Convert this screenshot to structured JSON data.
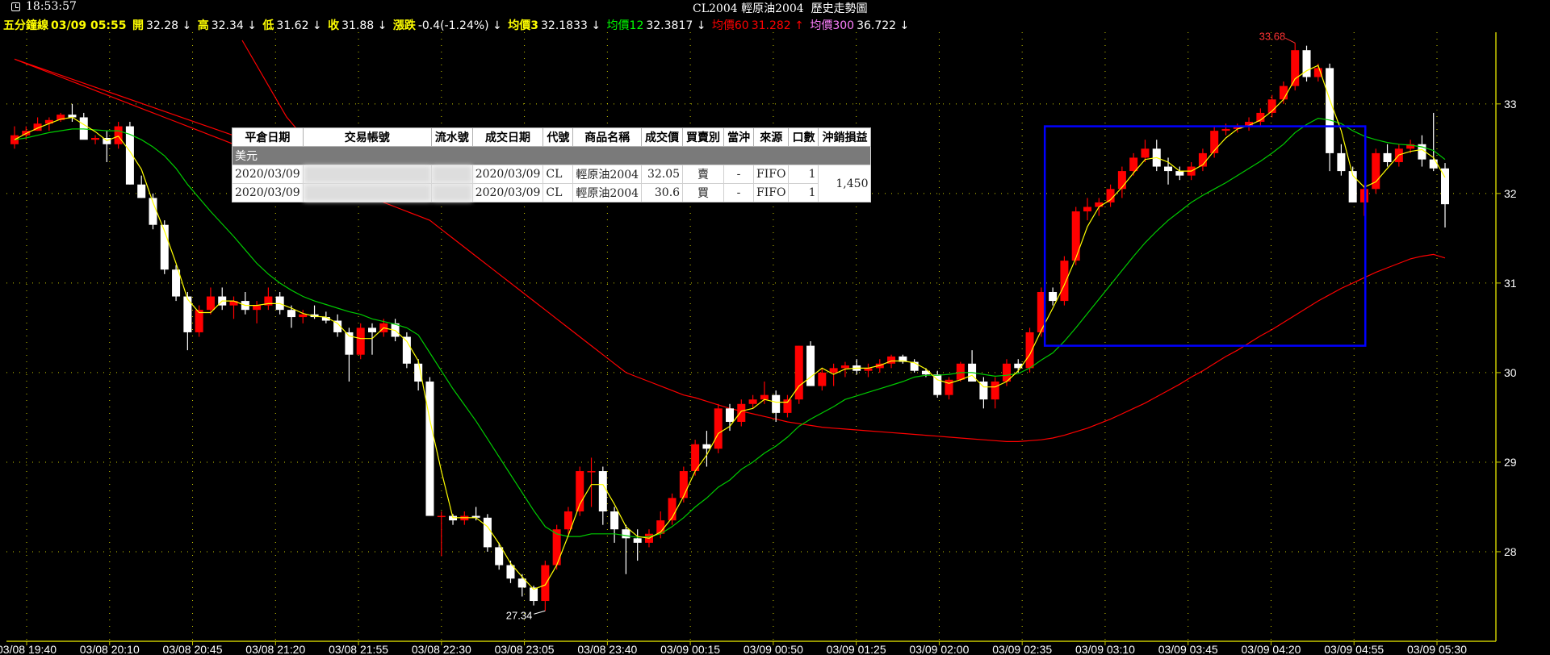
{
  "header": {
    "clock": "18:53:57",
    "title": "CL2004 輕原油2004  歷史走勢圖"
  },
  "infobar": {
    "period_label": "五分鐘線",
    "datetime": "03/09 05:55",
    "open_label": "開",
    "open": "32.28 ↓",
    "high_label": "高",
    "high": "32.34 ↓",
    "low_label": "低",
    "low": "31.62 ↓",
    "close_label": "收",
    "close": "31.88 ↓",
    "change_label": "漲跌",
    "change": "-0.4(-1.24%) ↓",
    "ma3_label": "均價3",
    "ma3": "32.1833 ↓",
    "ma12_label": "均價12",
    "ma12": "32.3817 ↓",
    "ma60_label": "均價60",
    "ma60": "31.282 ↑",
    "ma300_label": "均價300",
    "ma300": "36.722 ↓"
  },
  "colors": {
    "up": "#ff0000",
    "down": "#ffffff",
    "ma3": "#ffff00",
    "ma12": "#00cc00",
    "ma60": "#ff0000",
    "axis": "#c8c800",
    "grid": "#ffff00",
    "box": "#0000ff"
  },
  "chart_data": {
    "type": "candlestick",
    "title": "CL2004 輕原油2004  歷史走勢圖",
    "x_tick_labels": [
      "03/08 19:40",
      "03/08 20:10",
      "03/08 20:45",
      "03/08 21:20",
      "03/08 21:55",
      "03/08 22:30",
      "03/08 23:05",
      "03/08 23:40",
      "03/09 00:15",
      "03/09 00:50",
      "03/09 01:25",
      "03/09 02:00",
      "03/09 02:35",
      "03/09 03:10",
      "03/09 03:45",
      "03/09 04:20",
      "03/09 04:55",
      "03/09 05:30"
    ],
    "y_ticks": [
      28,
      29,
      30,
      31,
      32,
      33
    ],
    "ylim": [
      27.0,
      33.8
    ],
    "grid": true,
    "annotations": {
      "high_label": "33.68",
      "high_value": 33.68,
      "low_label": "27.34",
      "low_value": 27.34
    },
    "ohlc": [
      [
        32.55,
        32.75,
        32.5,
        32.65
      ],
      [
        32.65,
        32.75,
        32.6,
        32.7
      ],
      [
        32.7,
        32.85,
        32.7,
        32.78
      ],
      [
        32.78,
        32.85,
        32.7,
        32.82
      ],
      [
        32.82,
        32.9,
        32.8,
        32.88
      ],
      [
        32.88,
        33.0,
        32.8,
        32.85
      ],
      [
        32.85,
        32.9,
        32.8,
        32.6
      ],
      [
        32.6,
        32.65,
        32.55,
        32.62
      ],
      [
        32.62,
        32.7,
        32.35,
        32.55
      ],
      [
        32.55,
        32.8,
        32.5,
        32.75
      ],
      [
        32.75,
        32.8,
        32.1,
        32.1
      ],
      [
        32.1,
        32.2,
        31.95,
        31.95
      ],
      [
        31.95,
        32.0,
        31.6,
        31.65
      ],
      [
        31.65,
        31.7,
        31.1,
        31.15
      ],
      [
        31.15,
        31.2,
        30.8,
        30.85
      ],
      [
        30.85,
        30.9,
        30.25,
        30.45
      ],
      [
        30.45,
        30.75,
        30.4,
        30.7
      ],
      [
        30.7,
        30.95,
        30.65,
        30.85
      ],
      [
        30.85,
        30.95,
        30.7,
        30.75
      ],
      [
        30.75,
        30.85,
        30.6,
        30.8
      ],
      [
        30.8,
        30.9,
        30.65,
        30.7
      ],
      [
        30.7,
        30.8,
        30.55,
        30.75
      ],
      [
        30.75,
        30.95,
        30.7,
        30.85
      ],
      [
        30.85,
        30.9,
        30.65,
        30.7
      ],
      [
        30.7,
        30.75,
        30.5,
        30.62
      ],
      [
        30.62,
        30.7,
        30.55,
        30.65
      ],
      [
        30.65,
        30.75,
        30.6,
        30.62
      ],
      [
        30.62,
        30.68,
        30.55,
        30.58
      ],
      [
        30.58,
        30.65,
        30.4,
        30.45
      ],
      [
        30.45,
        30.5,
        29.9,
        30.2
      ],
      [
        30.2,
        30.55,
        30.15,
        30.5
      ],
      [
        30.5,
        30.55,
        30.2,
        30.45
      ],
      [
        30.45,
        30.6,
        30.4,
        30.55
      ],
      [
        30.55,
        30.6,
        30.35,
        30.4
      ],
      [
        30.4,
        30.45,
        30.05,
        30.1
      ],
      [
        30.1,
        30.15,
        29.8,
        29.9
      ],
      [
        29.9,
        29.95,
        28.4,
        28.4
      ],
      [
        28.4,
        28.45,
        27.95,
        28.4
      ],
      [
        28.4,
        28.42,
        28.3,
        28.35
      ],
      [
        28.35,
        28.45,
        28.3,
        28.4
      ],
      [
        28.4,
        28.5,
        28.35,
        28.38
      ],
      [
        28.38,
        28.42,
        28.0,
        28.05
      ],
      [
        28.05,
        28.1,
        27.8,
        27.85
      ],
      [
        27.85,
        27.9,
        27.65,
        27.7
      ],
      [
        27.7,
        27.75,
        27.5,
        27.6
      ],
      [
        27.6,
        27.62,
        27.4,
        27.45
      ],
      [
        27.45,
        27.9,
        27.34,
        27.85
      ],
      [
        27.85,
        28.3,
        27.8,
        28.25
      ],
      [
        28.25,
        28.5,
        28.2,
        28.45
      ],
      [
        28.45,
        28.95,
        28.4,
        28.9
      ],
      [
        28.9,
        29.05,
        28.5,
        28.9
      ],
      [
        28.9,
        28.95,
        28.3,
        28.45
      ],
      [
        28.45,
        28.5,
        28.1,
        28.25
      ],
      [
        28.25,
        28.3,
        27.75,
        28.15
      ],
      [
        28.15,
        28.25,
        27.9,
        28.1
      ],
      [
        28.1,
        28.25,
        28.05,
        28.2
      ],
      [
        28.2,
        28.45,
        28.15,
        28.35
      ],
      [
        28.35,
        28.65,
        28.3,
        28.6
      ],
      [
        28.6,
        28.95,
        28.55,
        28.9
      ],
      [
        28.9,
        29.25,
        28.85,
        29.2
      ],
      [
        29.2,
        29.35,
        28.95,
        29.15
      ],
      [
        29.15,
        29.65,
        29.1,
        29.6
      ],
      [
        29.6,
        29.65,
        29.35,
        29.45
      ],
      [
        29.45,
        29.7,
        29.4,
        29.65
      ],
      [
        29.65,
        29.75,
        29.6,
        29.7
      ],
      [
        29.7,
        29.9,
        29.65,
        29.75
      ],
      [
        29.75,
        29.8,
        29.45,
        29.55
      ],
      [
        29.55,
        29.75,
        29.5,
        29.7
      ],
      [
        29.7,
        30.3,
        29.65,
        30.3
      ],
      [
        30.3,
        30.35,
        29.85,
        29.85
      ],
      [
        29.85,
        30.05,
        29.8,
        30.0
      ],
      [
        30.0,
        30.1,
        29.85,
        30.05
      ],
      [
        30.05,
        30.12,
        29.95,
        30.08
      ],
      [
        30.08,
        30.15,
        29.98,
        30.02
      ],
      [
        30.02,
        30.1,
        29.95,
        30.05
      ],
      [
        30.05,
        30.15,
        30.0,
        30.1
      ],
      [
        30.1,
        30.2,
        30.05,
        30.18
      ],
      [
        30.18,
        30.2,
        30.1,
        30.12
      ],
      [
        30.12,
        30.15,
        30.0,
        30.02
      ],
      [
        30.02,
        30.05,
        29.95,
        29.98
      ],
      [
        29.98,
        30.02,
        29.72,
        29.75
      ],
      [
        29.75,
        29.95,
        29.7,
        29.92
      ],
      [
        29.92,
        30.12,
        29.9,
        30.1
      ],
      [
        30.1,
        30.25,
        29.9,
        29.9
      ],
      [
        29.9,
        29.95,
        29.6,
        29.7
      ],
      [
        29.7,
        29.95,
        29.6,
        29.9
      ],
      [
        29.9,
        30.15,
        29.85,
        30.1
      ],
      [
        30.1,
        30.15,
        30.0,
        30.05
      ],
      [
        30.05,
        30.5,
        30.0,
        30.45
      ],
      [
        30.45,
        30.95,
        30.4,
        30.9
      ],
      [
        30.9,
        30.95,
        30.75,
        30.8
      ],
      [
        30.8,
        31.3,
        30.75,
        31.25
      ],
      [
        31.25,
        31.85,
        31.2,
        31.8
      ],
      [
        31.8,
        31.95,
        31.7,
        31.85
      ],
      [
        31.85,
        31.95,
        31.75,
        31.9
      ],
      [
        31.9,
        32.1,
        31.85,
        32.05
      ],
      [
        32.05,
        32.3,
        31.95,
        32.25
      ],
      [
        32.25,
        32.45,
        32.2,
        32.4
      ],
      [
        32.4,
        32.6,
        32.35,
        32.5
      ],
      [
        32.5,
        32.6,
        32.25,
        32.3
      ],
      [
        32.3,
        32.4,
        32.1,
        32.25
      ],
      [
        32.25,
        32.3,
        32.15,
        32.2
      ],
      [
        32.2,
        32.35,
        32.15,
        32.3
      ],
      [
        32.3,
        32.5,
        32.25,
        32.45
      ],
      [
        32.45,
        32.75,
        32.4,
        32.7
      ],
      [
        32.7,
        32.78,
        32.65,
        32.72
      ],
      [
        32.72,
        32.78,
        32.68,
        32.75
      ],
      [
        32.75,
        32.85,
        32.7,
        32.8
      ],
      [
        32.8,
        32.95,
        32.75,
        32.9
      ],
      [
        32.9,
        33.1,
        32.85,
        33.05
      ],
      [
        33.05,
        33.25,
        33.0,
        33.2
      ],
      [
        33.2,
        33.68,
        33.15,
        33.6
      ],
      [
        33.6,
        33.65,
        33.25,
        33.3
      ],
      [
        33.3,
        33.45,
        33.25,
        33.4
      ],
      [
        33.4,
        33.45,
        32.25,
        32.45
      ],
      [
        32.45,
        32.55,
        32.2,
        32.25
      ],
      [
        32.25,
        32.3,
        31.9,
        31.9
      ],
      [
        31.9,
        32.1,
        31.75,
        32.05
      ],
      [
        32.05,
        32.5,
        32.0,
        32.45
      ],
      [
        32.45,
        32.55,
        32.3,
        32.35
      ],
      [
        32.35,
        32.55,
        32.3,
        32.5
      ],
      [
        32.5,
        32.6,
        32.45,
        32.55
      ],
      [
        32.55,
        32.65,
        32.3,
        32.38
      ],
      [
        32.38,
        32.9,
        32.25,
        32.28
      ],
      [
        32.28,
        32.34,
        31.62,
        31.88
      ]
    ],
    "series": [
      {
        "name": "均價3",
        "color": "#ffff00",
        "values": [
          32.6,
          32.67,
          32.73,
          32.78,
          32.83,
          32.85,
          32.77,
          32.69,
          32.59,
          32.64,
          32.47,
          32.27,
          31.9,
          31.58,
          31.22,
          30.82,
          30.67,
          30.67,
          30.8,
          30.8,
          30.75,
          30.75,
          30.77,
          30.77,
          30.72,
          30.66,
          30.63,
          30.62,
          30.55,
          30.41,
          30.38,
          30.38,
          30.5,
          30.47,
          30.35,
          30.13,
          29.47,
          28.9,
          28.38,
          28.38,
          28.38,
          28.28,
          28.09,
          27.87,
          27.72,
          27.58,
          27.63,
          27.85,
          28.18,
          28.53,
          28.75,
          28.75,
          28.53,
          28.28,
          28.17,
          28.15,
          28.22,
          28.38,
          28.62,
          28.9,
          29.08,
          29.32,
          29.4,
          29.57,
          29.6,
          29.7,
          29.67,
          29.67,
          29.85,
          29.95,
          30.05,
          29.98,
          30.04,
          30.05,
          30.05,
          30.08,
          30.13,
          30.13,
          30.11,
          30.04,
          29.92,
          29.88,
          29.92,
          29.97,
          29.84,
          29.84,
          29.9,
          30.02,
          30.2,
          30.47,
          30.72,
          30.98,
          31.28,
          31.63,
          31.85,
          31.93,
          32.07,
          32.23,
          32.38,
          32.4,
          32.35,
          32.25,
          32.25,
          32.32,
          32.48,
          32.62,
          32.72,
          32.76,
          32.82,
          32.92,
          33.05,
          33.28,
          33.37,
          33.43,
          33.05,
          32.7,
          32.2,
          32.07,
          32.13,
          32.28,
          32.43,
          32.47,
          32.49,
          32.4,
          32.18
        ]
      },
      {
        "name": "均價12",
        "color": "#00cc00",
        "values": [
          32.6,
          32.62,
          32.65,
          32.68,
          32.7,
          32.72,
          32.72,
          32.71,
          32.7,
          32.7,
          32.66,
          32.6,
          32.52,
          32.42,
          32.28,
          32.1,
          31.95,
          31.8,
          31.66,
          31.52,
          31.37,
          31.22,
          31.1,
          31.0,
          30.92,
          30.85,
          30.8,
          30.76,
          30.72,
          30.68,
          30.65,
          30.6,
          30.57,
          30.54,
          30.5,
          30.42,
          30.22,
          30.02,
          29.82,
          29.64,
          29.46,
          29.26,
          29.06,
          28.86,
          28.66,
          28.46,
          28.28,
          28.2,
          28.17,
          28.17,
          28.2,
          28.2,
          28.2,
          28.18,
          28.16,
          28.17,
          28.2,
          28.28,
          28.38,
          28.5,
          28.6,
          28.72,
          28.8,
          28.92,
          29.0,
          29.1,
          29.18,
          29.28,
          29.4,
          29.48,
          29.55,
          29.62,
          29.7,
          29.74,
          29.78,
          29.82,
          29.86,
          29.9,
          29.95,
          29.97,
          29.97,
          29.98,
          30.0,
          30.0,
          29.98,
          29.96,
          29.97,
          29.99,
          30.05,
          30.14,
          30.22,
          30.35,
          30.5,
          30.66,
          30.82,
          30.98,
          31.14,
          31.3,
          31.45,
          31.58,
          31.7,
          31.8,
          31.9,
          31.98,
          32.05,
          32.12,
          32.2,
          32.28,
          32.36,
          32.45,
          32.55,
          32.68,
          32.77,
          32.84,
          32.82,
          32.78,
          32.7,
          32.64,
          32.6,
          32.57,
          32.55,
          32.54,
          32.52,
          32.48,
          32.38
        ]
      },
      {
        "name": "均價60",
        "color": "#ff0000",
        "values": [
          33.5,
          33.45,
          33.4,
          33.35,
          33.3,
          33.25,
          33.2,
          33.15,
          33.1,
          33.05,
          33.0,
          32.95,
          32.9,
          32.85,
          32.8,
          32.75,
          32.7,
          32.65,
          32.6,
          32.55,
          32.5,
          32.45,
          32.4,
          32.35,
          32.3,
          32.25,
          32.2,
          32.15,
          32.1,
          32.05,
          32.0,
          31.95,
          31.9,
          31.85,
          31.8,
          31.75,
          31.7,
          31.6,
          31.5,
          31.4,
          31.3,
          31.2,
          31.1,
          31.0,
          30.9,
          30.8,
          30.7,
          30.6,
          30.5,
          30.4,
          30.3,
          30.2,
          30.1,
          30.0,
          29.95,
          29.9,
          29.85,
          29.8,
          29.75,
          29.72,
          29.68,
          29.64,
          29.6,
          29.57,
          29.54,
          29.51,
          29.48,
          29.45,
          29.43,
          29.41,
          29.39,
          29.38,
          29.37,
          29.36,
          29.35,
          29.34,
          29.33,
          29.32,
          29.31,
          29.3,
          29.29,
          29.28,
          29.27,
          29.26,
          29.25,
          29.24,
          29.23,
          29.23,
          29.24,
          29.25,
          29.27,
          29.3,
          29.34,
          29.38,
          29.43,
          29.48,
          29.54,
          29.6,
          29.66,
          29.73,
          29.8,
          29.87,
          29.95,
          30.02,
          30.1,
          30.18,
          30.25,
          30.33,
          30.41,
          30.48,
          30.56,
          30.64,
          30.72,
          30.8,
          30.87,
          30.94,
          31.0,
          31.06,
          31.12,
          31.17,
          31.22,
          31.27,
          31.3,
          31.32,
          31.28
        ]
      }
    ],
    "highlight_box": {
      "x_from": "03/09 02:35",
      "x_to": "03/09 04:55",
      "y_from": 30.3,
      "y_to": 32.75
    }
  },
  "trade_table": {
    "headers": [
      "平倉日期",
      "交易帳號",
      "流水號",
      "成交日期",
      "代號",
      "商品名稱",
      "成交價",
      "買賣別",
      "當沖",
      "來源",
      "口數",
      "沖銷損益"
    ],
    "group_label": "美元",
    "rows": [
      {
        "close_date": "2020/03/09",
        "account": "",
        "serial": "",
        "trade_date": "2020/03/09",
        "code": "CL",
        "name": "輕原油2004",
        "price": "32.05",
        "side": "賣",
        "daytrade": "-",
        "source": "FIFO",
        "qty": "1"
      },
      {
        "close_date": "2020/03/09",
        "account": "",
        "serial": "",
        "trade_date": "2020/03/09",
        "code": "CL",
        "name": "輕原油2004",
        "price": "30.6",
        "side": "買",
        "daytrade": "-",
        "source": "FIFO",
        "qty": "1"
      }
    ],
    "pnl": "1,450"
  }
}
